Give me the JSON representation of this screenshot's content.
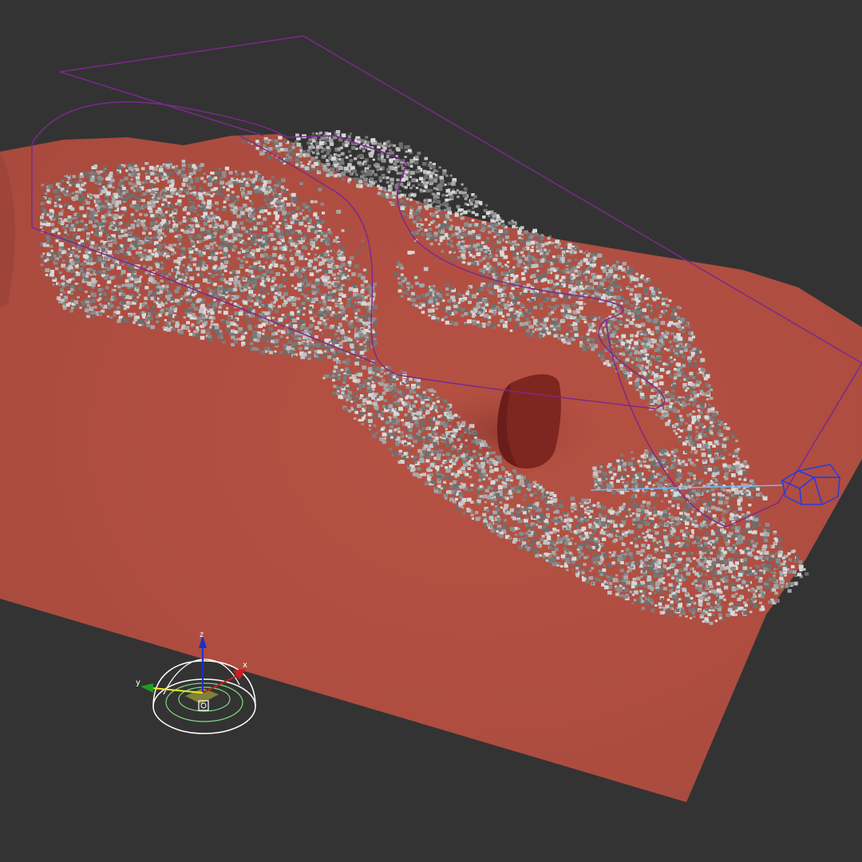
{
  "viewport": {
    "background": "#333333",
    "ground_color": "#B04D40",
    "ground_shade": "#9F4439",
    "particle_colors": [
      "#8C8C8C",
      "#A8A8A8",
      "#C4C4C4",
      "#6E6E6E",
      "#D9D9D9",
      "#7A7A7A"
    ],
    "spline_color": "#7B2A8C",
    "camera_color": "#2A3BE0",
    "camera_line_color": "#7AB8F0",
    "obstacle_color": "#7E2620"
  },
  "gizmo": {
    "axis_x_label": "x",
    "axis_y_label": "y",
    "axis_z_label": "z",
    "axis_x_color": "#C81E1E",
    "axis_y_color": "#1E9E1E",
    "axis_z_color": "#1E2ECC",
    "icon": "transform-gizmo-icon"
  },
  "objects": {
    "camera_icon": "camera-frustum-icon",
    "spline_icon": "flow-path-spline",
    "emitter_icon": "particle-emitter-icon",
    "obstacle_icon": "collider-rock-icon"
  }
}
